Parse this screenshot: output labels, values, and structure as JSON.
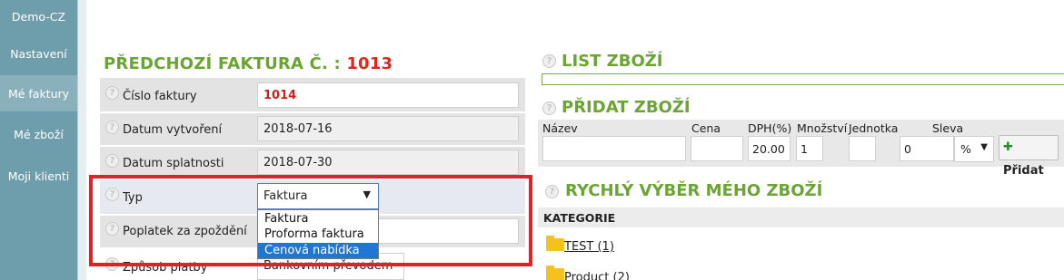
{
  "sidebar": {
    "items": [
      {
        "label": "Demo-CZ"
      },
      {
        "label": "Nastavení"
      },
      {
        "label": "Mé faktury"
      },
      {
        "label": "Mé zboží"
      },
      {
        "label": "Moji klienti"
      }
    ],
    "active": "Mé faktury"
  },
  "invoice": {
    "heading_prefix": "PŘEDCHOZÍ FAKTURA Č. :",
    "heading_number": "1013",
    "fields": {
      "number": {
        "label": "Číslo faktury",
        "value": "1014"
      },
      "created": {
        "label": "Datum vytvoření",
        "value": "2018-07-16"
      },
      "due": {
        "label": "Datum splatnosti",
        "value": "2018-07-30"
      },
      "type": {
        "label": "Typ",
        "value": "Faktura",
        "options": [
          "Faktura",
          "Proforma faktura",
          "Cenová nabídka"
        ],
        "highlighted": "Cenová nabídka"
      },
      "late_fee": {
        "label": "Poplatek za zpoždění",
        "value": ""
      },
      "payment": {
        "label": "Způsob platby",
        "value": "Bankovním převodem"
      }
    }
  },
  "list_goods": {
    "title": "LIST ZBOŽÍ"
  },
  "add_goods": {
    "title": "PŘIDAT ZBOŽÍ",
    "labels": {
      "name": "Název",
      "price": "Cena",
      "vat": "DPH(%)",
      "qty": "Množství",
      "unit": "Jednotka",
      "discount": "Sleva"
    },
    "values": {
      "name": "",
      "price": "",
      "vat": "20.00",
      "qty": "1",
      "unit": "",
      "discount": "0",
      "discount_type": "%"
    },
    "add_button": "Přidat"
  },
  "quick_select": {
    "title": "RYCHLÝ VÝBĚR MÉHO ZBOŽÍ",
    "category_header": "KATEGORIE",
    "categories": [
      {
        "label": "TEST (1)"
      },
      {
        "label": "Product (2)"
      }
    ]
  },
  "colors": {
    "accent_green": "#6aa534",
    "accent_red": "#e0261b",
    "sidebar": "#6e9eab",
    "highlight": "#1e77d3"
  }
}
